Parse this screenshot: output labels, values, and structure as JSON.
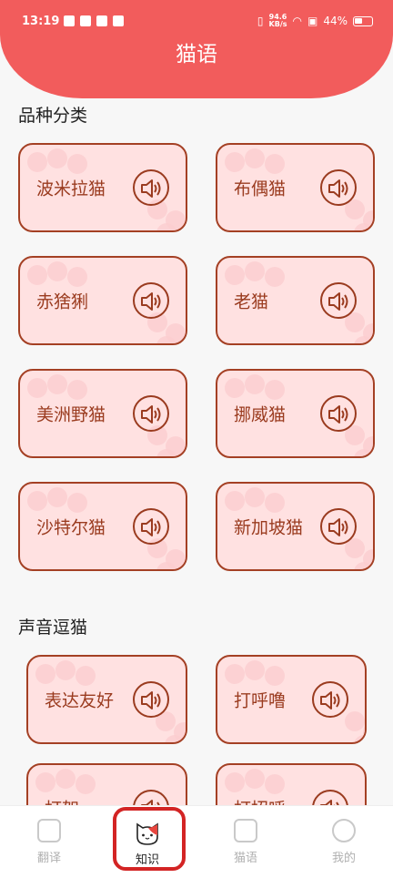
{
  "status_bar": {
    "time": "13:19",
    "speed_value": "94.6",
    "speed_unit": "KB/s",
    "battery": "44%"
  },
  "header": {
    "title": "猫语"
  },
  "sections": [
    {
      "title": "品种分类",
      "items": [
        "波米拉猫",
        "布偶猫",
        "赤猞猁",
        "老猫",
        "美洲野猫",
        "挪威猫",
        "沙特尔猫",
        "新加坡猫"
      ]
    },
    {
      "title": "声音逗猫",
      "items": [
        "表达友好",
        "打呼噜",
        "打架",
        "打招呼"
      ]
    }
  ],
  "tabs": [
    {
      "label": "翻译",
      "icon": "translate-icon"
    },
    {
      "label": "知识",
      "icon": "cat-face-icon",
      "active": true
    },
    {
      "label": "猫语",
      "icon": "cat-language-icon"
    },
    {
      "label": "我的",
      "icon": "profile-icon"
    }
  ],
  "colors": {
    "header": "#f25c5c",
    "card_bg": "#ffe1e1",
    "card_border": "#a44024",
    "highlight": "#d32424"
  }
}
